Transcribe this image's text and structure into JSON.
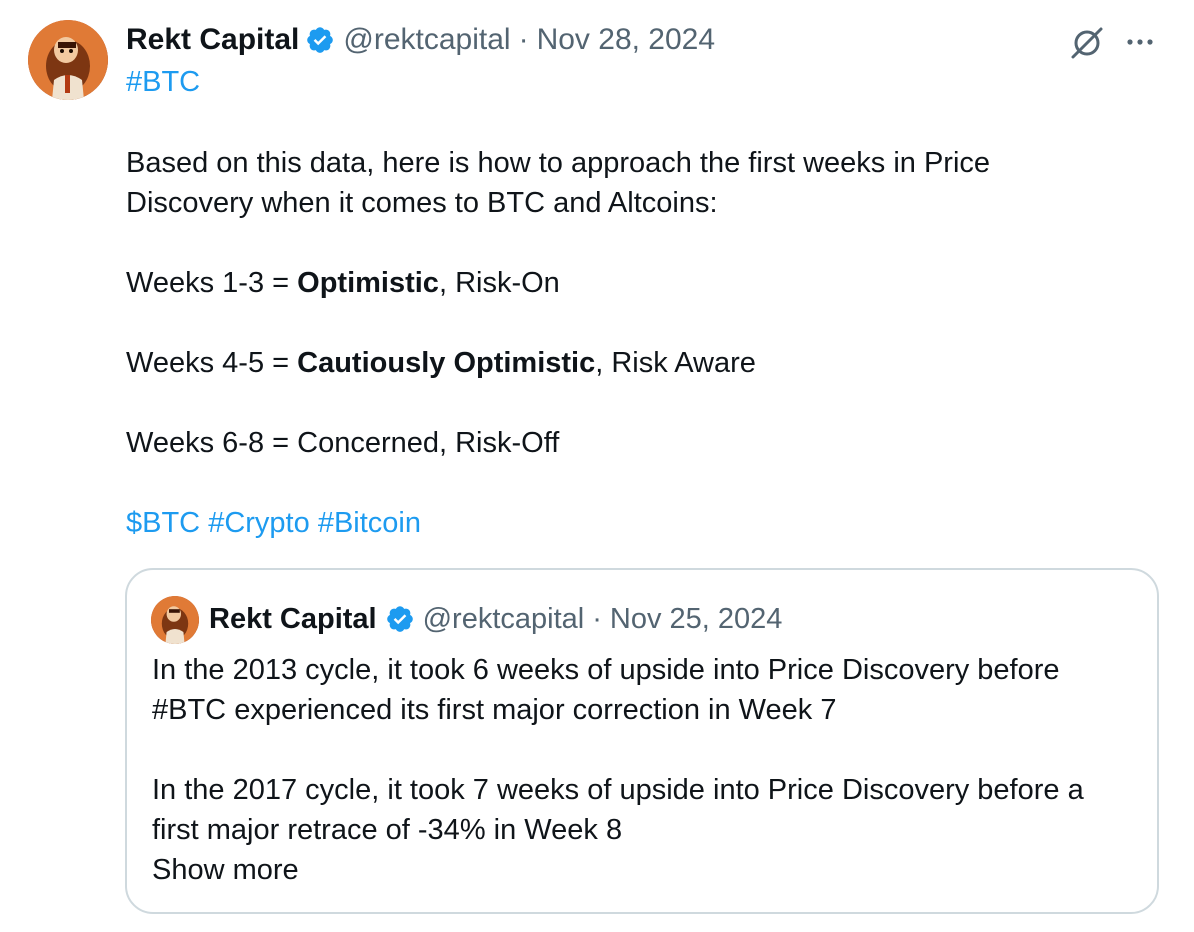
{
  "tweet": {
    "author_name": "Rekt Capital",
    "handle": "@rektcapital",
    "separator": "·",
    "date": "Nov 28, 2024",
    "hashtag_top": "#BTC",
    "line1": "Based on this data, here is how to approach the first weeks in Price",
    "line2": "Discovery when it comes to BTC and Altcoins:",
    "weeks_1_3_prefix": "Weeks 1-3 = ",
    "weeks_1_3_bold": "Optimistic",
    "weeks_1_3_suffix": ", Risk-On",
    "weeks_4_5_prefix": "Weeks 4-5 = ",
    "weeks_4_5_bold": "Cautiously Optimistic",
    "weeks_4_5_suffix": ", Risk Aware",
    "weeks_6_8": "Weeks 6-8 = Concerned, Risk-Off",
    "tags": [
      "$BTC",
      "#Crypto",
      "#Bitcoin"
    ],
    "icons": {
      "verified": "verified-badge-icon",
      "grok": "grok-icon",
      "more": "more-options-icon"
    },
    "colors": {
      "link": "#1d9bf0",
      "text": "#0f1419",
      "secondary": "#536471",
      "border": "#cfd9de"
    }
  },
  "quote": {
    "author_name": "Rekt Capital",
    "handle": "@rektcapital",
    "separator": "·",
    "date": "Nov 25, 2024",
    "line1": "In the 2013 cycle, it took 6 weeks of upside into Price Discovery before",
    "line2_hashtag": "#BTC",
    "line2_rest": " experienced its first major correction in Week 7",
    "line3": "In the 2017 cycle, it took 7 weeks of upside into Price Discovery before a",
    "line4": "first major retrace of -34% in Week 8",
    "show_more": "Show more"
  }
}
